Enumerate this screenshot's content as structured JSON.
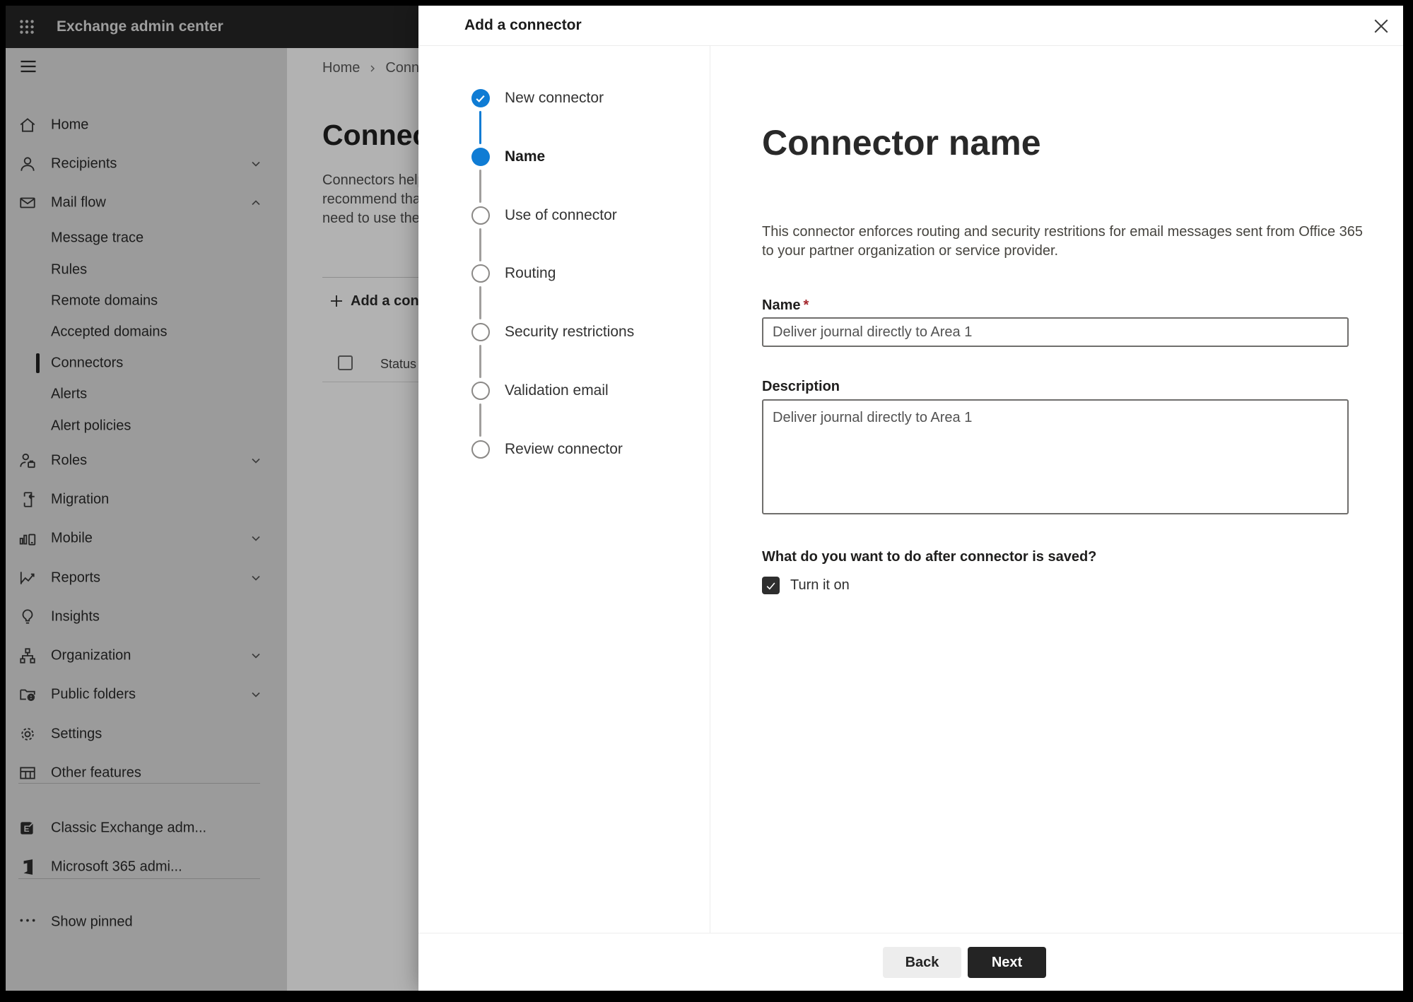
{
  "topbar": {
    "title": "Exchange admin center"
  },
  "sidebar": {
    "items": [
      {
        "label": "Home"
      },
      {
        "label": "Recipients",
        "chevron": "down"
      },
      {
        "label": "Mail flow",
        "chevron": "up"
      },
      {
        "label": "Message trace",
        "sub": true
      },
      {
        "label": "Rules",
        "sub": true
      },
      {
        "label": "Remote domains",
        "sub": true
      },
      {
        "label": "Accepted domains",
        "sub": true
      },
      {
        "label": "Connectors",
        "sub": true,
        "selected": true
      },
      {
        "label": "Alerts",
        "sub": true
      },
      {
        "label": "Alert policies",
        "sub": true
      },
      {
        "label": "Roles",
        "chevron": "down"
      },
      {
        "label": "Migration"
      },
      {
        "label": "Mobile",
        "chevron": "down"
      },
      {
        "label": "Reports",
        "chevron": "down"
      },
      {
        "label": "Insights"
      },
      {
        "label": "Organization",
        "chevron": "down"
      },
      {
        "label": "Public folders",
        "chevron": "down"
      },
      {
        "label": "Settings"
      },
      {
        "label": "Other features"
      },
      {
        "label": "Classic Exchange adm..."
      },
      {
        "label": "Microsoft 365 admi..."
      },
      {
        "label": "Show pinned"
      }
    ]
  },
  "page": {
    "breadcrumb": {
      "home": "Home",
      "current": "Conne"
    },
    "title": "Connect",
    "paragraph_lines": [
      "Connectors help",
      "recommend that",
      "need to use ther"
    ],
    "add_button_label": "Add a conn",
    "status_header": "Status"
  },
  "dialog": {
    "title": "Add a connector",
    "steps": [
      {
        "label": "New connector",
        "state": "completed"
      },
      {
        "label": "Name",
        "state": "current"
      },
      {
        "label": "Use of connector",
        "state": "upcoming"
      },
      {
        "label": "Routing",
        "state": "upcoming"
      },
      {
        "label": "Security restrictions",
        "state": "upcoming"
      },
      {
        "label": "Validation email",
        "state": "upcoming"
      },
      {
        "label": "Review connector",
        "state": "upcoming"
      }
    ],
    "content": {
      "heading": "Connector name",
      "description_line1": "This connector enforces routing and security restritions for email messages sent from Office 365",
      "description_line2": "to your partner organization or service provider.",
      "name_label": "Name",
      "required_star": "*",
      "name_value": "Deliver journal directly to Area 1",
      "description_label": "Description",
      "description_value": "Deliver journal directly to Area 1",
      "after_save_question": "What do you want to do after connector is saved?",
      "turn_on_label": "Turn it on",
      "turn_on_checked": "true"
    },
    "footer": {
      "back_label": "Back",
      "next_label": "Next"
    }
  },
  "colors": {
    "accent_blue": "#0f7cd4",
    "topbar_bg": "#1a1a1a",
    "sidebar_dimmed_bg": "#9b9b9b",
    "page_dimmed_bg": "#b2b2b2",
    "dialog_bg": "#ffffff",
    "next_button_bg": "#242424",
    "back_button_bg": "#ededed",
    "required_star": "#a4262c",
    "checkbox_checked_bg": "#2e2e2e"
  }
}
